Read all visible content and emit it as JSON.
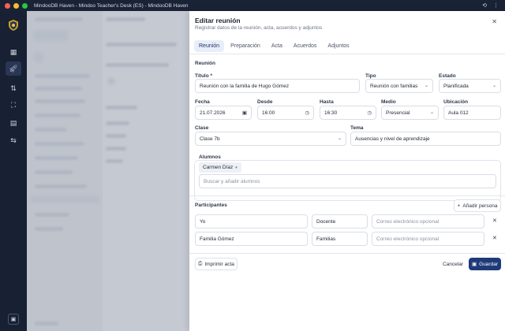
{
  "window": {
    "title": "MindooDB Haven - Mindoo Teacher's Desk (ES) - MindooDB Haven"
  },
  "sidebar": {
    "icons": [
      "shield-logo",
      "grid-icon",
      "rocket-icon",
      "arrows-icon",
      "scan-icon",
      "calendar-icon",
      "switch-icon",
      "settings-icon"
    ]
  },
  "panel": {
    "title": "Editar reunión",
    "subtitle": "Registrar datos de la reunión, acta, acuerdos y adjuntos",
    "tabs": [
      {
        "label": "Reunión",
        "active": true
      },
      {
        "label": "Preparación",
        "active": false
      },
      {
        "label": "Acta",
        "active": false
      },
      {
        "label": "Acuerdos",
        "active": false
      },
      {
        "label": "Adjuntos",
        "active": false
      }
    ],
    "section_label": "Reunión",
    "fields": {
      "titulo": {
        "label": "Título *",
        "value": "Reunión con la familia de Hugo Gómez"
      },
      "tipo": {
        "label": "Tipo",
        "value": "Reunión con familias"
      },
      "estado": {
        "label": "Estado",
        "value": "Planificada"
      },
      "fecha": {
        "label": "Fecha",
        "value": "21.07.2026"
      },
      "desde": {
        "label": "Desde",
        "value": "16:00"
      },
      "hasta": {
        "label": "Hasta",
        "value": "16:30"
      },
      "medio": {
        "label": "Medio",
        "value": "Presencial"
      },
      "ubicacion": {
        "label": "Ubicación",
        "value": "Aula 012"
      },
      "clase": {
        "label": "Clase",
        "value": "Clase 7b"
      },
      "tema": {
        "label": "Tema",
        "value": "Ausencias y nivel de aprendizaje"
      }
    },
    "alumnos": {
      "label": "Alumnos",
      "chip": "Carmen Díaz",
      "placeholder": "Buscar y añadir alumnos"
    },
    "participantes": {
      "label": "Participantes",
      "add_button": "Añadir persona",
      "rows": [
        {
          "name": "Yo",
          "role": "Docente",
          "email_placeholder": "Correo electrónico opcional"
        },
        {
          "name": "Familia Gómez",
          "role": "Familias",
          "email_placeholder": "Correo electrónico opcional"
        }
      ]
    },
    "footer": {
      "print": "Imprimir acta",
      "cancel": "Cancelar",
      "save": "Guardar"
    }
  },
  "colors": {
    "sidebar": "#182033",
    "primary": "#1f3a78",
    "active_tab_bg": "#e8eef9"
  }
}
